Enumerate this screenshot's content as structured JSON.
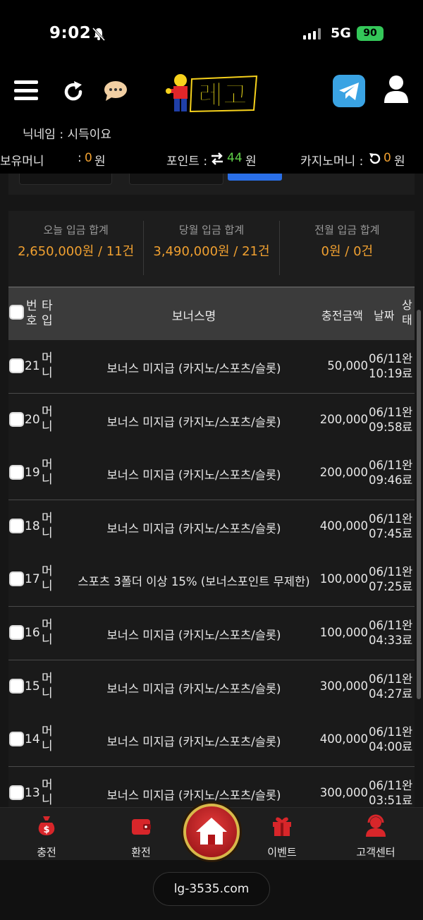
{
  "status_bar": {
    "time": "9:02",
    "network": "5G",
    "battery": "90"
  },
  "header": {
    "nickname": "닉네임 : 시득이요",
    "balance_label": "보유머니",
    "balance_value": "0",
    "balance_unit": "원",
    "points_label": "포인트 :",
    "points_value": "44",
    "points_unit": "원",
    "casino_label": "카지노머니 :",
    "casino_value": "0",
    "casino_unit": "원",
    "colon": ":"
  },
  "summary": [
    {
      "label": "오늘 입금 합계",
      "value": "2,650,000원 / 11건"
    },
    {
      "label": "당월 입금 합계",
      "value": "3,490,000원 / 21건"
    },
    {
      "label": "전월 입금 합계",
      "value": "0원 / 0건"
    }
  ],
  "table": {
    "headers": {
      "num": "번호",
      "type": "타입",
      "name": "보너스명",
      "amount": "충전금액",
      "date": "날짜",
      "status": "상태"
    },
    "rows": [
      {
        "num": "21",
        "type": "머니",
        "name": "보너스 미지급 (카지노/스포츠/슬롯)",
        "amount": "50,000",
        "date": "06/11",
        "time": "10:19",
        "status": "완료"
      },
      {
        "num": "20",
        "type": "머니",
        "name": "보너스 미지급 (카지노/스포츠/슬롯)",
        "amount": "200,000",
        "date": "06/11",
        "time": "09:58",
        "status": "완료"
      },
      {
        "num": "19",
        "type": "머니",
        "name": "보너스 미지급 (카지노/스포츠/슬롯)",
        "amount": "200,000",
        "date": "06/11",
        "time": "09:46",
        "status": "완료"
      },
      {
        "num": "18",
        "type": "머니",
        "name": "보너스 미지급 (카지노/스포츠/슬롯)",
        "amount": "400,000",
        "date": "06/11",
        "time": "07:45",
        "status": "완료"
      },
      {
        "num": "17",
        "type": "머니",
        "name": "스포츠 3폴더 이상 15% (보너스포인트 무제한)",
        "amount": "100,000",
        "date": "06/11",
        "time": "07:25",
        "status": "완료"
      },
      {
        "num": "16",
        "type": "머니",
        "name": "보너스 미지급 (카지노/스포츠/슬롯)",
        "amount": "100,000",
        "date": "06/11",
        "time": "04:33",
        "status": "완료"
      },
      {
        "num": "15",
        "type": "머니",
        "name": "보너스 미지급 (카지노/스포츠/슬롯)",
        "amount": "300,000",
        "date": "06/11",
        "time": "04:27",
        "status": "완료"
      },
      {
        "num": "14",
        "type": "머니",
        "name": "보너스 미지급 (카지노/스포츠/슬롯)",
        "amount": "400,000",
        "date": "06/11",
        "time": "04:00",
        "status": "완료"
      },
      {
        "num": "13",
        "type": "머니",
        "name": "보너스 미지급 (카지노/스포츠/슬롯)",
        "amount": "300,000",
        "date": "06/11",
        "time": "03:51",
        "status": "완료"
      }
    ]
  },
  "bottom_nav": {
    "deposit": "충전",
    "withdraw": "환전",
    "event": "이벤트",
    "support": "고객센터"
  },
  "url": "lg-3535.com",
  "colors": {
    "accent_orange": "#f0a030",
    "accent_green": "#5ecf48",
    "home_red": "#c8181c"
  }
}
